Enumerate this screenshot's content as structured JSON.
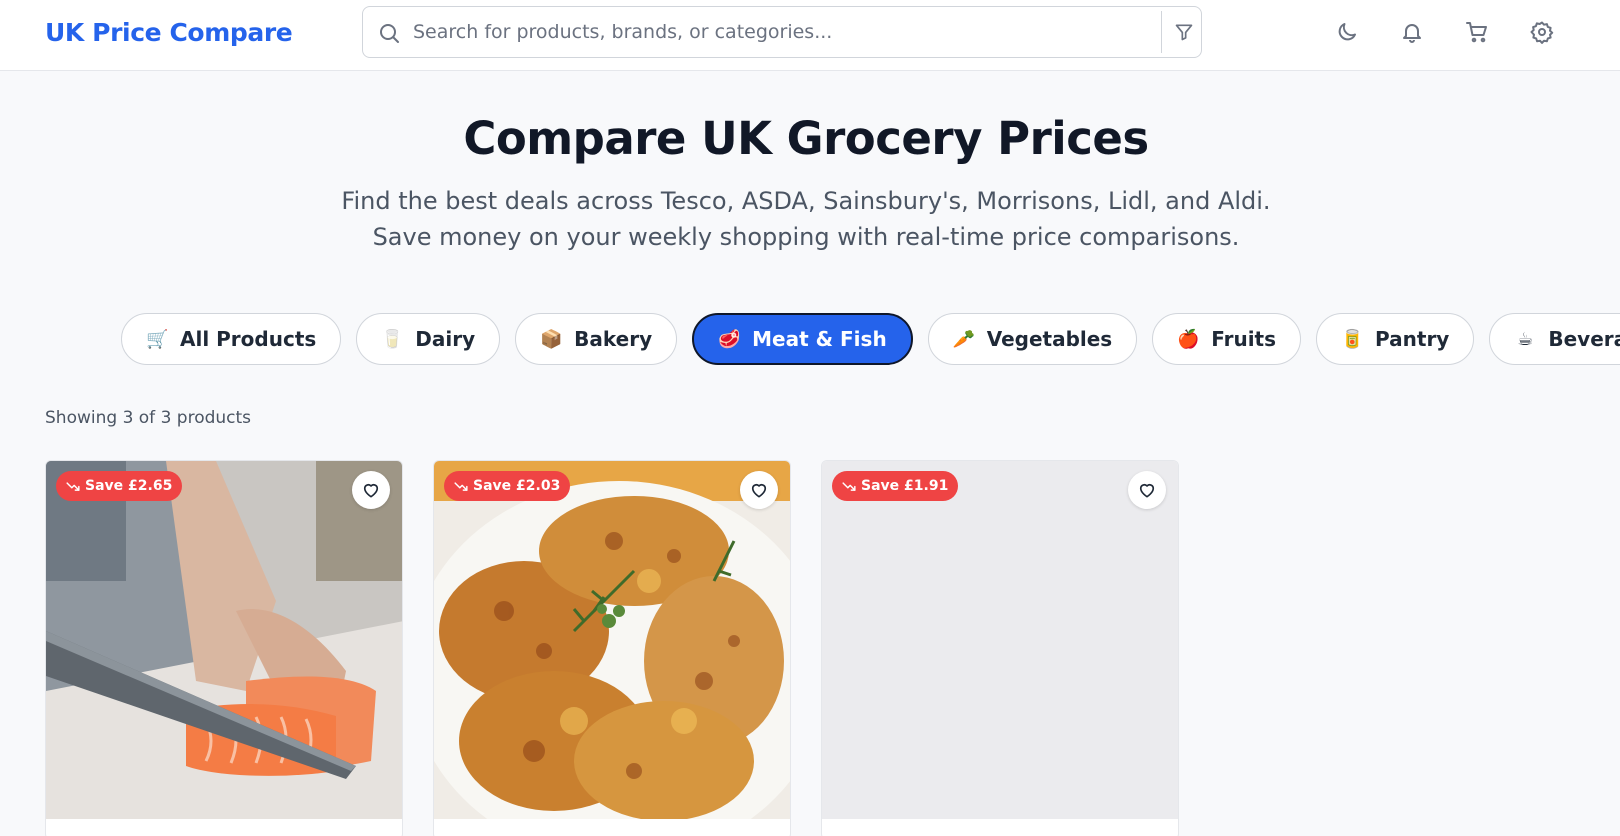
{
  "header": {
    "logo": "UK Price Compare",
    "search_placeholder": "Search for products, brands, or categories...",
    "icons": [
      "moon-icon",
      "bell-icon",
      "cart-icon",
      "gear-icon"
    ]
  },
  "hero": {
    "title": "Compare UK Grocery Prices",
    "subtitle": "Find the best deals across Tesco, ASDA, Sainsbury's, Morrisons, Lidl, and Aldi. Save money on your weekly shopping with real-time price comparisons."
  },
  "categories": [
    {
      "label": "All Products",
      "emoji": "🛒",
      "active": false
    },
    {
      "label": "Dairy",
      "emoji": "🥛",
      "active": false
    },
    {
      "label": "Bakery",
      "emoji": "📦",
      "active": false
    },
    {
      "label": "Meat & Fish",
      "emoji": "🥩",
      "active": true
    },
    {
      "label": "Vegetables",
      "emoji": "🥕",
      "active": false
    },
    {
      "label": "Fruits",
      "emoji": "🍎",
      "active": false
    },
    {
      "label": "Pantry",
      "emoji": "🥫",
      "active": false
    },
    {
      "label": "Beverages",
      "emoji": "☕",
      "active": false
    }
  ],
  "results": {
    "count_text": "Showing 3 of 3 products"
  },
  "products": [
    {
      "badge": "Save £2.65",
      "image": "salmon-fillet"
    },
    {
      "badge": "Save £2.03",
      "image": "roast-chicken"
    },
    {
      "badge": "Save £1.91",
      "image": "placeholder"
    }
  ],
  "colors": {
    "accent": "#2563eb",
    "badge": "#ef4444",
    "background": "#f8f9fb"
  }
}
